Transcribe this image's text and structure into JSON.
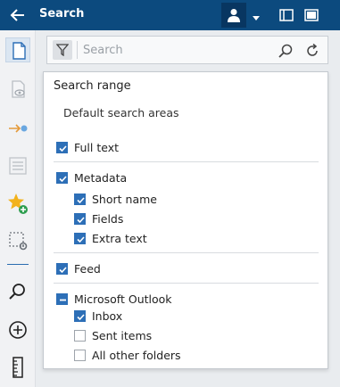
{
  "titlebar": {
    "title": "Search"
  },
  "search": {
    "placeholder": "Search"
  },
  "panel": {
    "header": "Search range",
    "subheader": "Default search areas",
    "options": [
      {
        "label": "Full text",
        "state": "checked"
      },
      {
        "label": "Metadata",
        "state": "checked"
      },
      {
        "label": "Short name",
        "state": "checked"
      },
      {
        "label": "Fields",
        "state": "checked"
      },
      {
        "label": "Extra text",
        "state": "checked"
      },
      {
        "label": "Feed",
        "state": "checked"
      },
      {
        "label": "Microsoft Outlook",
        "state": "indeterminate"
      },
      {
        "label": "Inbox",
        "state": "checked"
      },
      {
        "label": "Sent items",
        "state": "unchecked"
      },
      {
        "label": "All other folders",
        "state": "unchecked"
      }
    ]
  },
  "colors": {
    "titlebar": "#0c4a7e",
    "accent": "#2d6fb7"
  }
}
